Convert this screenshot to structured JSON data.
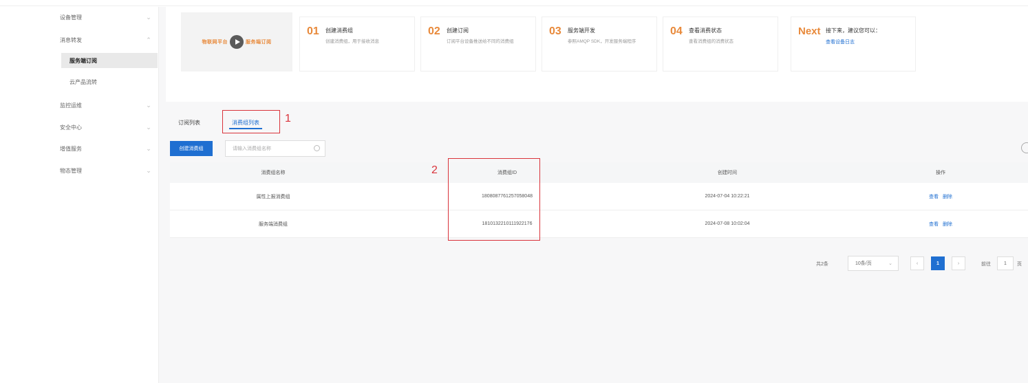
{
  "sidebar": {
    "items": [
      {
        "label": "设备管理"
      },
      {
        "label": "消息转发"
      },
      {
        "label": "服务端订阅"
      },
      {
        "label": "云产品流转"
      },
      {
        "label": "监控运维"
      },
      {
        "label": "安全中心"
      },
      {
        "label": "增值服务"
      },
      {
        "label": "物态管理"
      }
    ]
  },
  "guide": {
    "video_left": "物联网平台",
    "video_right": "服务端订阅",
    "steps": [
      {
        "num": "01",
        "title": "创建消费组",
        "desc": "创建消费组，用于接收消息"
      },
      {
        "num": "02",
        "title": "创建订阅",
        "desc": "订阅平台设备推送给不同的消费组"
      },
      {
        "num": "03",
        "title": "服务端开发",
        "desc": "参照AMQP SDK，开发服务端程序"
      },
      {
        "num": "04",
        "title": "查看消费状态",
        "desc": "查看消费组的消费状态"
      },
      {
        "num": "Next",
        "title": "接下来，建议您可以：",
        "link": "查看设备日志"
      }
    ]
  },
  "tabs": [
    {
      "label": "订阅列表"
    },
    {
      "label": "消费组列表"
    }
  ],
  "annotations": {
    "one": "1",
    "two": "2"
  },
  "toolbar": {
    "create_label": "创建消费组",
    "search_placeholder": "请输入消费组名称"
  },
  "table": {
    "headers": [
      "消费组名称",
      "消费组ID",
      "创建时间",
      "操作"
    ],
    "rows": [
      {
        "name": "属性上报消费组",
        "id": "1808087761257058048",
        "created": "2024-07-04 10:22:21",
        "ops": [
          "查看",
          "删除"
        ]
      },
      {
        "name": "服务端消费组",
        "id": "1810132210111922176",
        "created": "2024-07-08 10:02:04",
        "ops": [
          "查看",
          "删除"
        ]
      }
    ]
  },
  "pagination": {
    "total": "共2条",
    "page_size": "10条/页",
    "prev": "‹",
    "current": "1",
    "next": "›",
    "goto_label": "前往",
    "goto_value": "1",
    "page_suffix": "页"
  },
  "colors": {
    "accent": "#1f6fd1",
    "annotation": "#d9323a",
    "step_number": "#e8893a"
  }
}
